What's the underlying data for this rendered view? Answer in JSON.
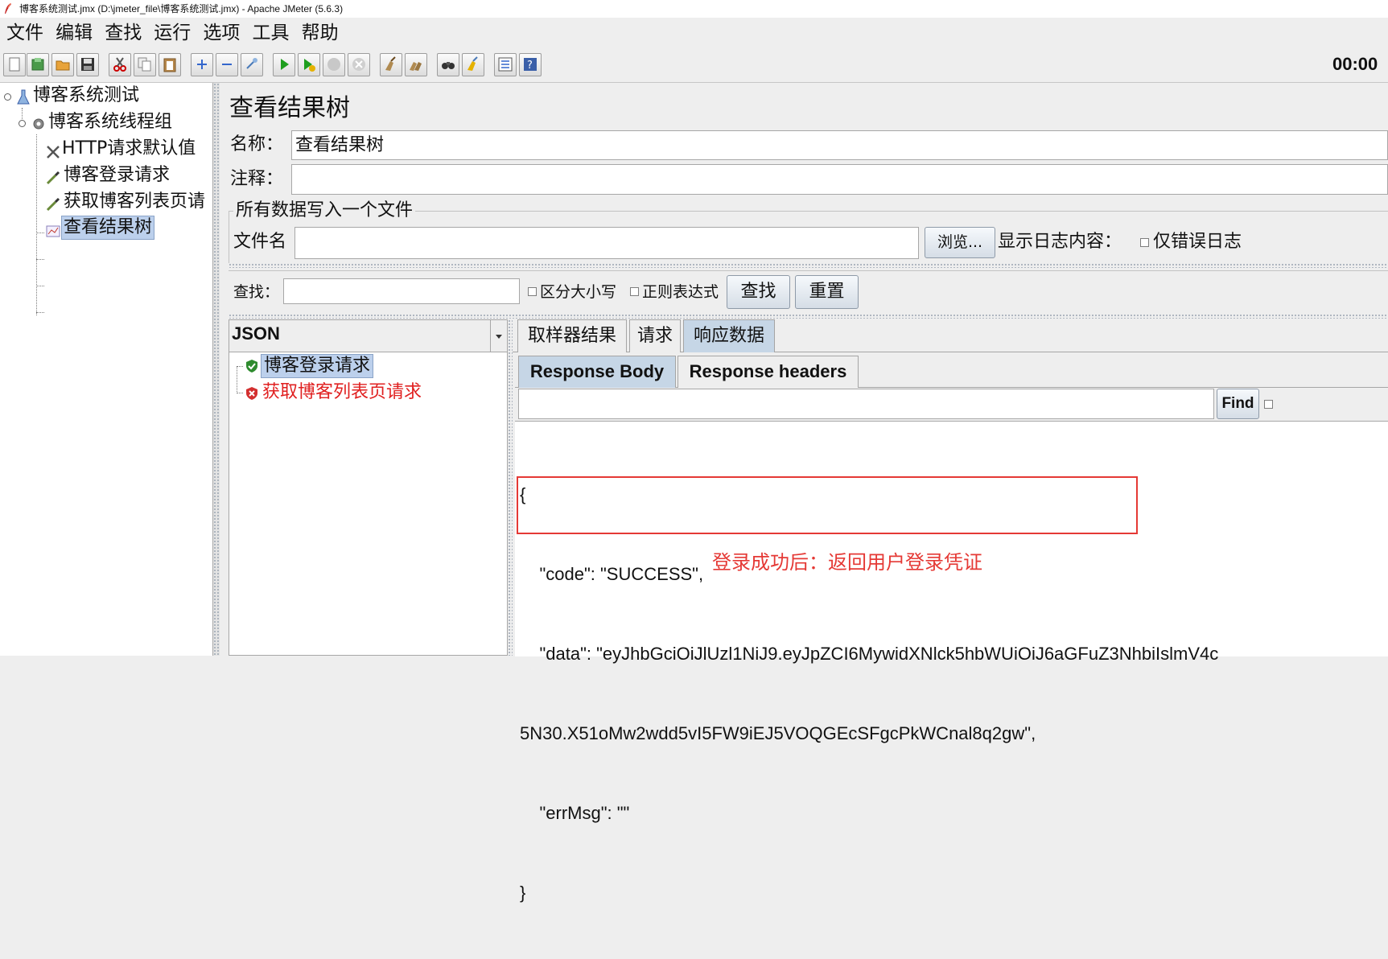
{
  "window": {
    "title": "博客系统测试.jmx (D:\\jmeter_file\\博客系统测试.jmx) - Apache JMeter (5.6.3)"
  },
  "menu": [
    "文件",
    "编辑",
    "查找",
    "运行",
    "选项",
    "工具",
    "帮助"
  ],
  "toolbar": {
    "timer": "00:00"
  },
  "tree": {
    "root": "博客系统测试",
    "thread_group": "博客系统线程组",
    "children": [
      "HTTP请求默认值",
      "博客登录请求",
      "获取博客列表页请",
      "查看结果树"
    ],
    "selected": "查看结果树"
  },
  "panel": {
    "title": "查看结果树",
    "name_label": "名称：",
    "name_value": "查看结果树",
    "comment_label": "注释：",
    "comment_value": "",
    "file_section": "所有数据写入一个文件",
    "file_label": "文件名",
    "file_value": "",
    "browse": "浏览...",
    "log_label": "显示日志内容：",
    "errors_only": "仅错误日志"
  },
  "search": {
    "label": "查找：",
    "value": "",
    "case_sensitive": "区分大小写",
    "regex": "正则表达式",
    "find": "查找",
    "reset": "重置"
  },
  "results": {
    "renderer": "JSON",
    "samples": [
      {
        "label": "博客登录请求",
        "status": "success"
      },
      {
        "label": "获取博客列表页请求",
        "status": "error"
      }
    ]
  },
  "tabs": {
    "items": [
      "取样器结果",
      "请求",
      "响应数据"
    ],
    "active": "响应数据"
  },
  "subtabs": {
    "items": [
      "Response Body",
      "Response headers"
    ],
    "active": "Response Body"
  },
  "body_search": {
    "value": "",
    "find": "Find"
  },
  "response": {
    "lines": [
      "{",
      "    \"code\": \"SUCCESS\",",
      "    \"data\": \"eyJhbGciOiJlUzl1NiJ9.eyJpZCI6MywidXNlck5hbWUiOiJ6aGFuZ3NhbiIslmV4c",
      "5N30.X51oMw2wdd5vI5FW9iEJ5VOQGEcSFgcPkWCnal8q2gw\",",
      "    \"errMsg\": \"\"",
      "}"
    ]
  },
  "annotation": {
    "text": "登录成功后：返回用户登录凭证",
    "color": "#e53935"
  },
  "colors": {
    "selection": "#bcd0ec",
    "active_tab": "#c6d6e6",
    "error_red": "#e02020"
  }
}
